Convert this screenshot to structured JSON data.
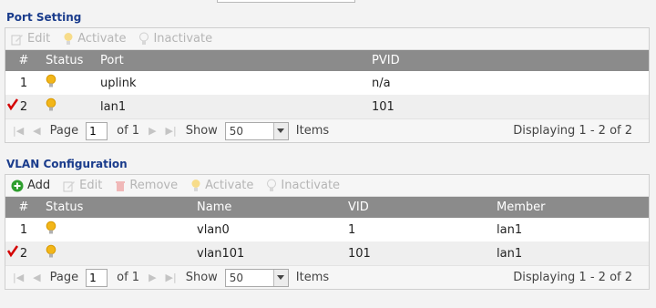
{
  "port_setting": {
    "title": "Port Setting",
    "toolbar": {
      "edit": "Edit",
      "activate": "Activate",
      "inactivate": "Inactivate"
    },
    "columns": {
      "num": "#",
      "status": "Status",
      "port": "Port",
      "pvid": "PVID"
    },
    "rows": [
      {
        "num": "1",
        "port": "uplink",
        "pvid": "n/a"
      },
      {
        "num": "2",
        "port": "lan1",
        "pvid": "101"
      }
    ],
    "pager": {
      "page_label": "Page",
      "page_value": "1",
      "of_label": "of 1",
      "show_label": "Show",
      "show_value": "50",
      "items_label": "Items",
      "display_text": "Displaying 1 - 2 of 2"
    }
  },
  "vlan_configuration": {
    "title": "VLAN Configuration",
    "toolbar": {
      "add": "Add",
      "edit": "Edit",
      "remove": "Remove",
      "activate": "Activate",
      "inactivate": "Inactivate"
    },
    "columns": {
      "num": "#",
      "status": "Status",
      "name": "Name",
      "vid": "VID",
      "member": "Member"
    },
    "rows": [
      {
        "num": "1",
        "name": "vlan0",
        "vid": "1",
        "member": "lan1"
      },
      {
        "num": "2",
        "name": "vlan101",
        "vid": "101",
        "member": "lan1"
      }
    ],
    "pager": {
      "page_label": "Page",
      "page_value": "1",
      "of_label": "of 1",
      "show_label": "Show",
      "show_value": "50",
      "items_label": "Items",
      "display_text": "Displaying 1 - 2 of 2"
    }
  },
  "colors": {
    "title": "#1a3c8c",
    "header_bg": "#8b8b8b",
    "bulb": "#f2b619",
    "check": "#d40000",
    "add": "#2e9e2e"
  },
  "icons": {
    "edit": "edit-icon",
    "activate": "lightbulb-icon",
    "inactivate": "lightbulb-off-icon",
    "add": "plus-circle-icon",
    "remove": "trash-icon",
    "status": "lightbulb-on-icon",
    "selected": "red-check-icon",
    "dropdown": "chevron-down-icon",
    "first": "first-page-icon",
    "prev": "prev-page-icon",
    "next": "next-page-icon",
    "last": "last-page-icon"
  }
}
